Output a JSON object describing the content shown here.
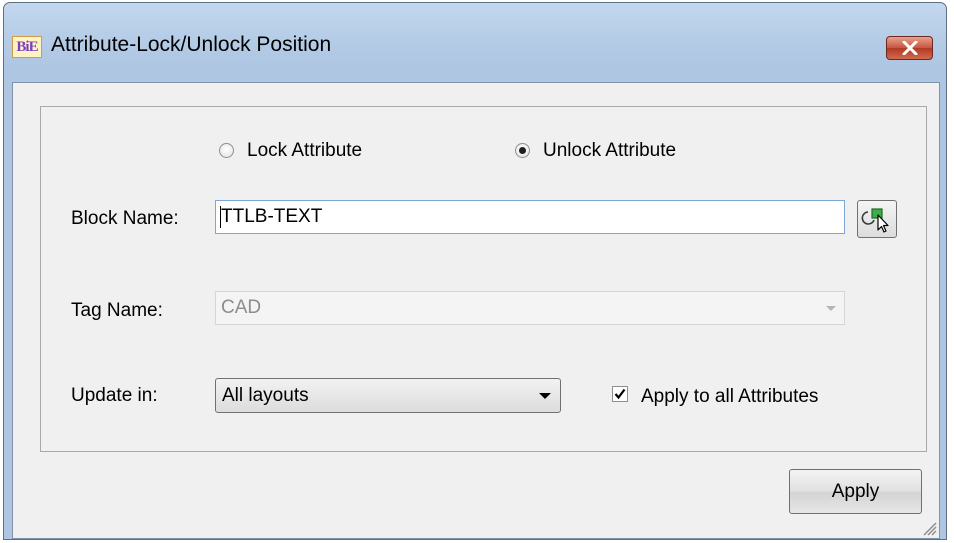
{
  "window": {
    "title": "Attribute-Lock/Unlock Position",
    "app_icon_text": "BiE"
  },
  "mode": {
    "options": [
      {
        "label": "Lock Attribute",
        "selected": false
      },
      {
        "label": "Unlock Attribute",
        "selected": true
      }
    ]
  },
  "block_name": {
    "label": "Block Name:",
    "value": "TTLB-TEXT",
    "pick_icon": "select-object-icon"
  },
  "tag_name": {
    "label": "Tag Name:",
    "value": "CAD",
    "enabled": false
  },
  "update_in": {
    "label": "Update in:",
    "value": "All layouts"
  },
  "apply_all": {
    "label": "Apply to all Attributes",
    "checked": true
  },
  "apply_button": {
    "label": "Apply"
  }
}
